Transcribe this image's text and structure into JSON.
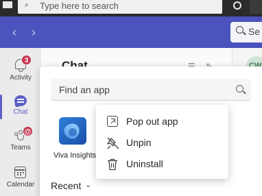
{
  "taskbar": {
    "search_placeholder": "Type here to search"
  },
  "titlebar": {
    "back_glyph": "‹",
    "forward_glyph": "›",
    "search_label": "Se"
  },
  "rail": {
    "items": [
      {
        "label": "Activity",
        "icon": "bell-icon",
        "badge": "3"
      },
      {
        "label": "Chat",
        "icon": "chat-icon",
        "active": true
      },
      {
        "label": "Teams",
        "icon": "teams-icon",
        "badge": "@"
      },
      {
        "label": "Calendar",
        "icon": "calendar-icon"
      }
    ]
  },
  "chat_panel": {
    "header": "Chat",
    "avatar_initials": "CW"
  },
  "flyout": {
    "find_placeholder": "Find an app",
    "apps": [
      {
        "label": "Viva Insights",
        "icon": "viva-insights-icon"
      }
    ],
    "recent_label": "Recent",
    "recent_chevron": "⌄"
  },
  "context_menu": {
    "items": [
      {
        "label": "Pop out app",
        "icon": "pop-out-icon"
      },
      {
        "label": "Unpin",
        "icon": "unpin-icon"
      },
      {
        "label": "Uninstall",
        "icon": "trash-icon"
      }
    ]
  },
  "colors": {
    "teams_purple": "#4b53bc",
    "accent": "#5b5fc7",
    "badge": "#c4314b"
  }
}
